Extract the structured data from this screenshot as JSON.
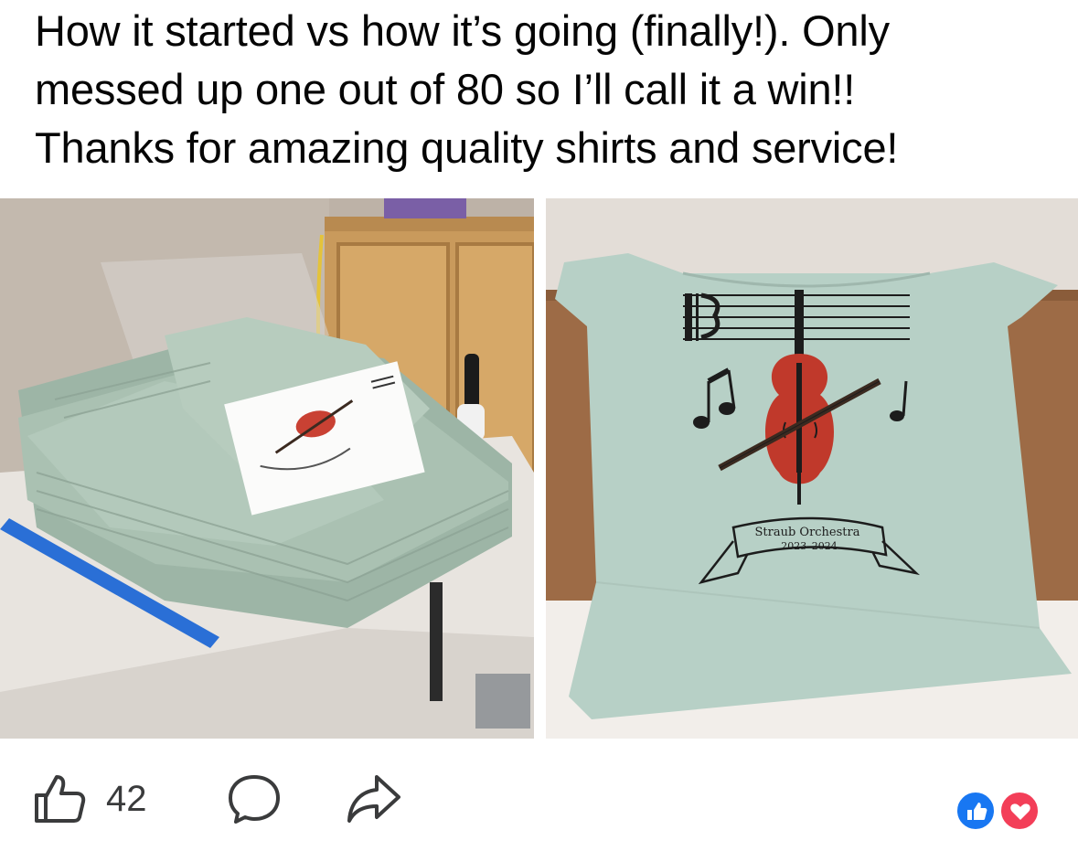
{
  "post": {
    "text_lines": [
      "How it started vs how it’s going (finally!). Only",
      "messed up one out of 80 so I’ll call it a win!!",
      "Thanks for amazing quality shirts and service!"
    ]
  },
  "photos": {
    "left": {
      "icon": "photo-stack-of-shirts"
    },
    "right": {
      "banner_line1": "Straub Orchestra",
      "banner_line2": "2023–2024"
    }
  },
  "actions": {
    "like_count": "42",
    "like_icon": "thumbs-up-icon",
    "comment_icon": "comment-icon",
    "share_icon": "share-icon"
  },
  "reactions": [
    "like",
    "love"
  ],
  "colors": {
    "shirt": "#a9c2b2",
    "shirt_right": "#b7d0c6",
    "cello": "#c0392b",
    "like_blue": "#1877f2",
    "love_red": "#f33e58"
  }
}
